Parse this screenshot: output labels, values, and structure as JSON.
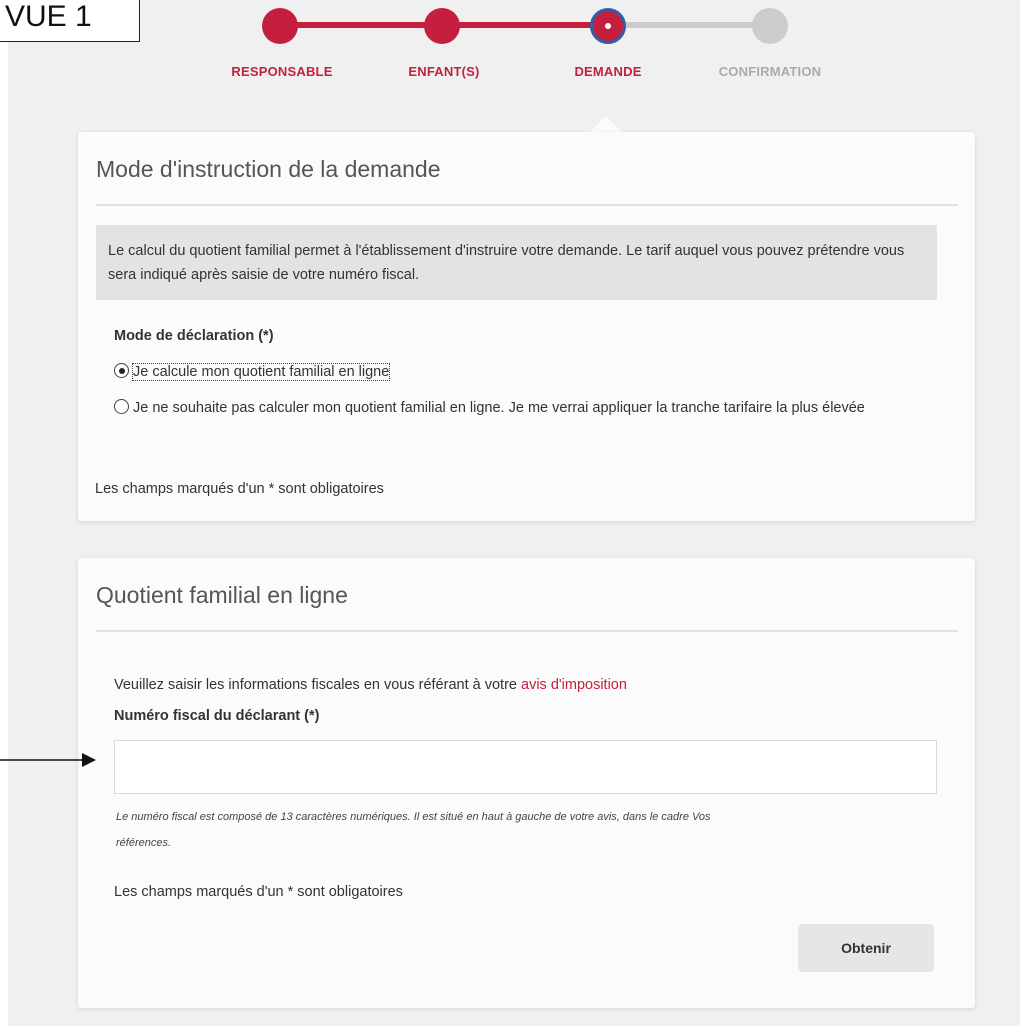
{
  "annotation": {
    "label": "VUE 1"
  },
  "stepper": {
    "steps": [
      {
        "label": "RESPONSABLE",
        "state": "done"
      },
      {
        "label": "ENFANT(S)",
        "state": "done"
      },
      {
        "label": "DEMANDE",
        "state": "current"
      },
      {
        "label": "CONFIRMATION",
        "state": "todo"
      }
    ],
    "colors": {
      "active": "#c41f3e",
      "inactive": "#cccccc"
    }
  },
  "card1": {
    "title": "Mode d'instruction de la demande",
    "info": "Le calcul du quotient familial permet à l'établissement d'instruire votre demande. Le tarif auquel vous pouvez prétendre vous sera indiqué après saisie de votre numéro fiscal.",
    "field_label": "Mode de déclaration (*)",
    "options": [
      {
        "label": "Je calcule mon quotient familial en ligne",
        "checked": true
      },
      {
        "label": "Je ne souhaite pas calculer mon quotient familial en ligne. Je me verrai appliquer la tranche tarifaire la plus élevée",
        "checked": false
      }
    ],
    "required_note": "Les champs marqués d'un * sont obligatoires"
  },
  "card2": {
    "title": "Quotient familial en ligne",
    "intro": "Veuillez saisir les informations fiscales en vous référant à votre",
    "intro_link": "avis d'imposition",
    "field_label": "Numéro fiscal du déclarant (*)",
    "input_value": "",
    "hint": "Le numéro fiscal est composé de 13 caractères numériques. Il est situé en haut à gauche de votre avis, dans le cadre Vos références.",
    "required_note": "Les champs marqués d'un * sont obligatoires",
    "button_label": "Obtenir"
  }
}
